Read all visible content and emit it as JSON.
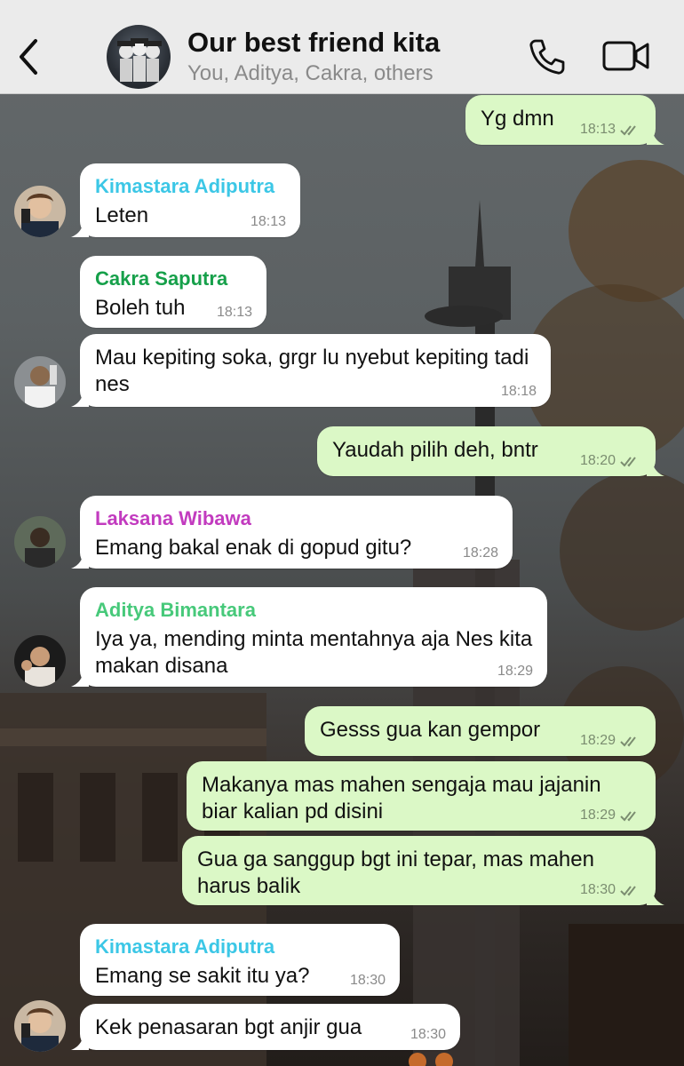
{
  "header": {
    "title": "Our best friend kita",
    "subtitle": "You, Aditya, Cakra, others"
  },
  "colors": {
    "outgoing_bubble": "#dbf8c6",
    "incoming_bubble": "#ffffff",
    "kimastara": "#3cc7e6",
    "cakra": "#16a04a",
    "laksana": "#c23bbf",
    "aditya": "#47c97a",
    "read_ticks": "#7b8d70"
  },
  "messages": [
    {
      "direction": "out",
      "text": "Yg dmn",
      "time": "18:13",
      "status": "read"
    },
    {
      "direction": "in",
      "sender": "Kimastara Adiputra",
      "text": "Leten",
      "time": "18:13"
    },
    {
      "direction": "in",
      "sender": "Cakra Saputra",
      "text": "Boleh tuh",
      "time": "18:13"
    },
    {
      "direction": "in",
      "text": "Mau kepiting soka, grgr lu nyebut kepiting tadi nes",
      "time": "18:18"
    },
    {
      "direction": "out",
      "text": "Yaudah pilih deh, bntr",
      "time": "18:20",
      "status": "read"
    },
    {
      "direction": "in",
      "sender": "Laksana Wibawa",
      "text": "Emang bakal enak di gopud gitu?",
      "time": "18:28"
    },
    {
      "direction": "in",
      "sender": "Aditya Bimantara",
      "text": "Iya ya, mending minta mentahnya aja Nes kita makan disana",
      "time": "18:29"
    },
    {
      "direction": "out",
      "text": "Gesss gua kan gempor",
      "time": "18:29",
      "status": "read"
    },
    {
      "direction": "out",
      "text": "Makanya mas mahen sengaja mau jajanin biar kalian pd disini",
      "time": "18:29",
      "status": "read"
    },
    {
      "direction": "out",
      "text": "Gua ga sanggup bgt ini tepar, mas mahen harus balik",
      "time": "18:30",
      "status": "read"
    },
    {
      "direction": "in",
      "sender": "Kimastara Adiputra",
      "text": "Emang se sakit itu ya?",
      "time": "18:30"
    },
    {
      "direction": "in",
      "text": "Kek penasaran bgt anjir gua",
      "time": "18:30"
    }
  ],
  "icons": {
    "back": "chevron-left-icon",
    "call": "phone-icon",
    "video": "video-camera-icon",
    "read_status": "double-check-icon"
  }
}
